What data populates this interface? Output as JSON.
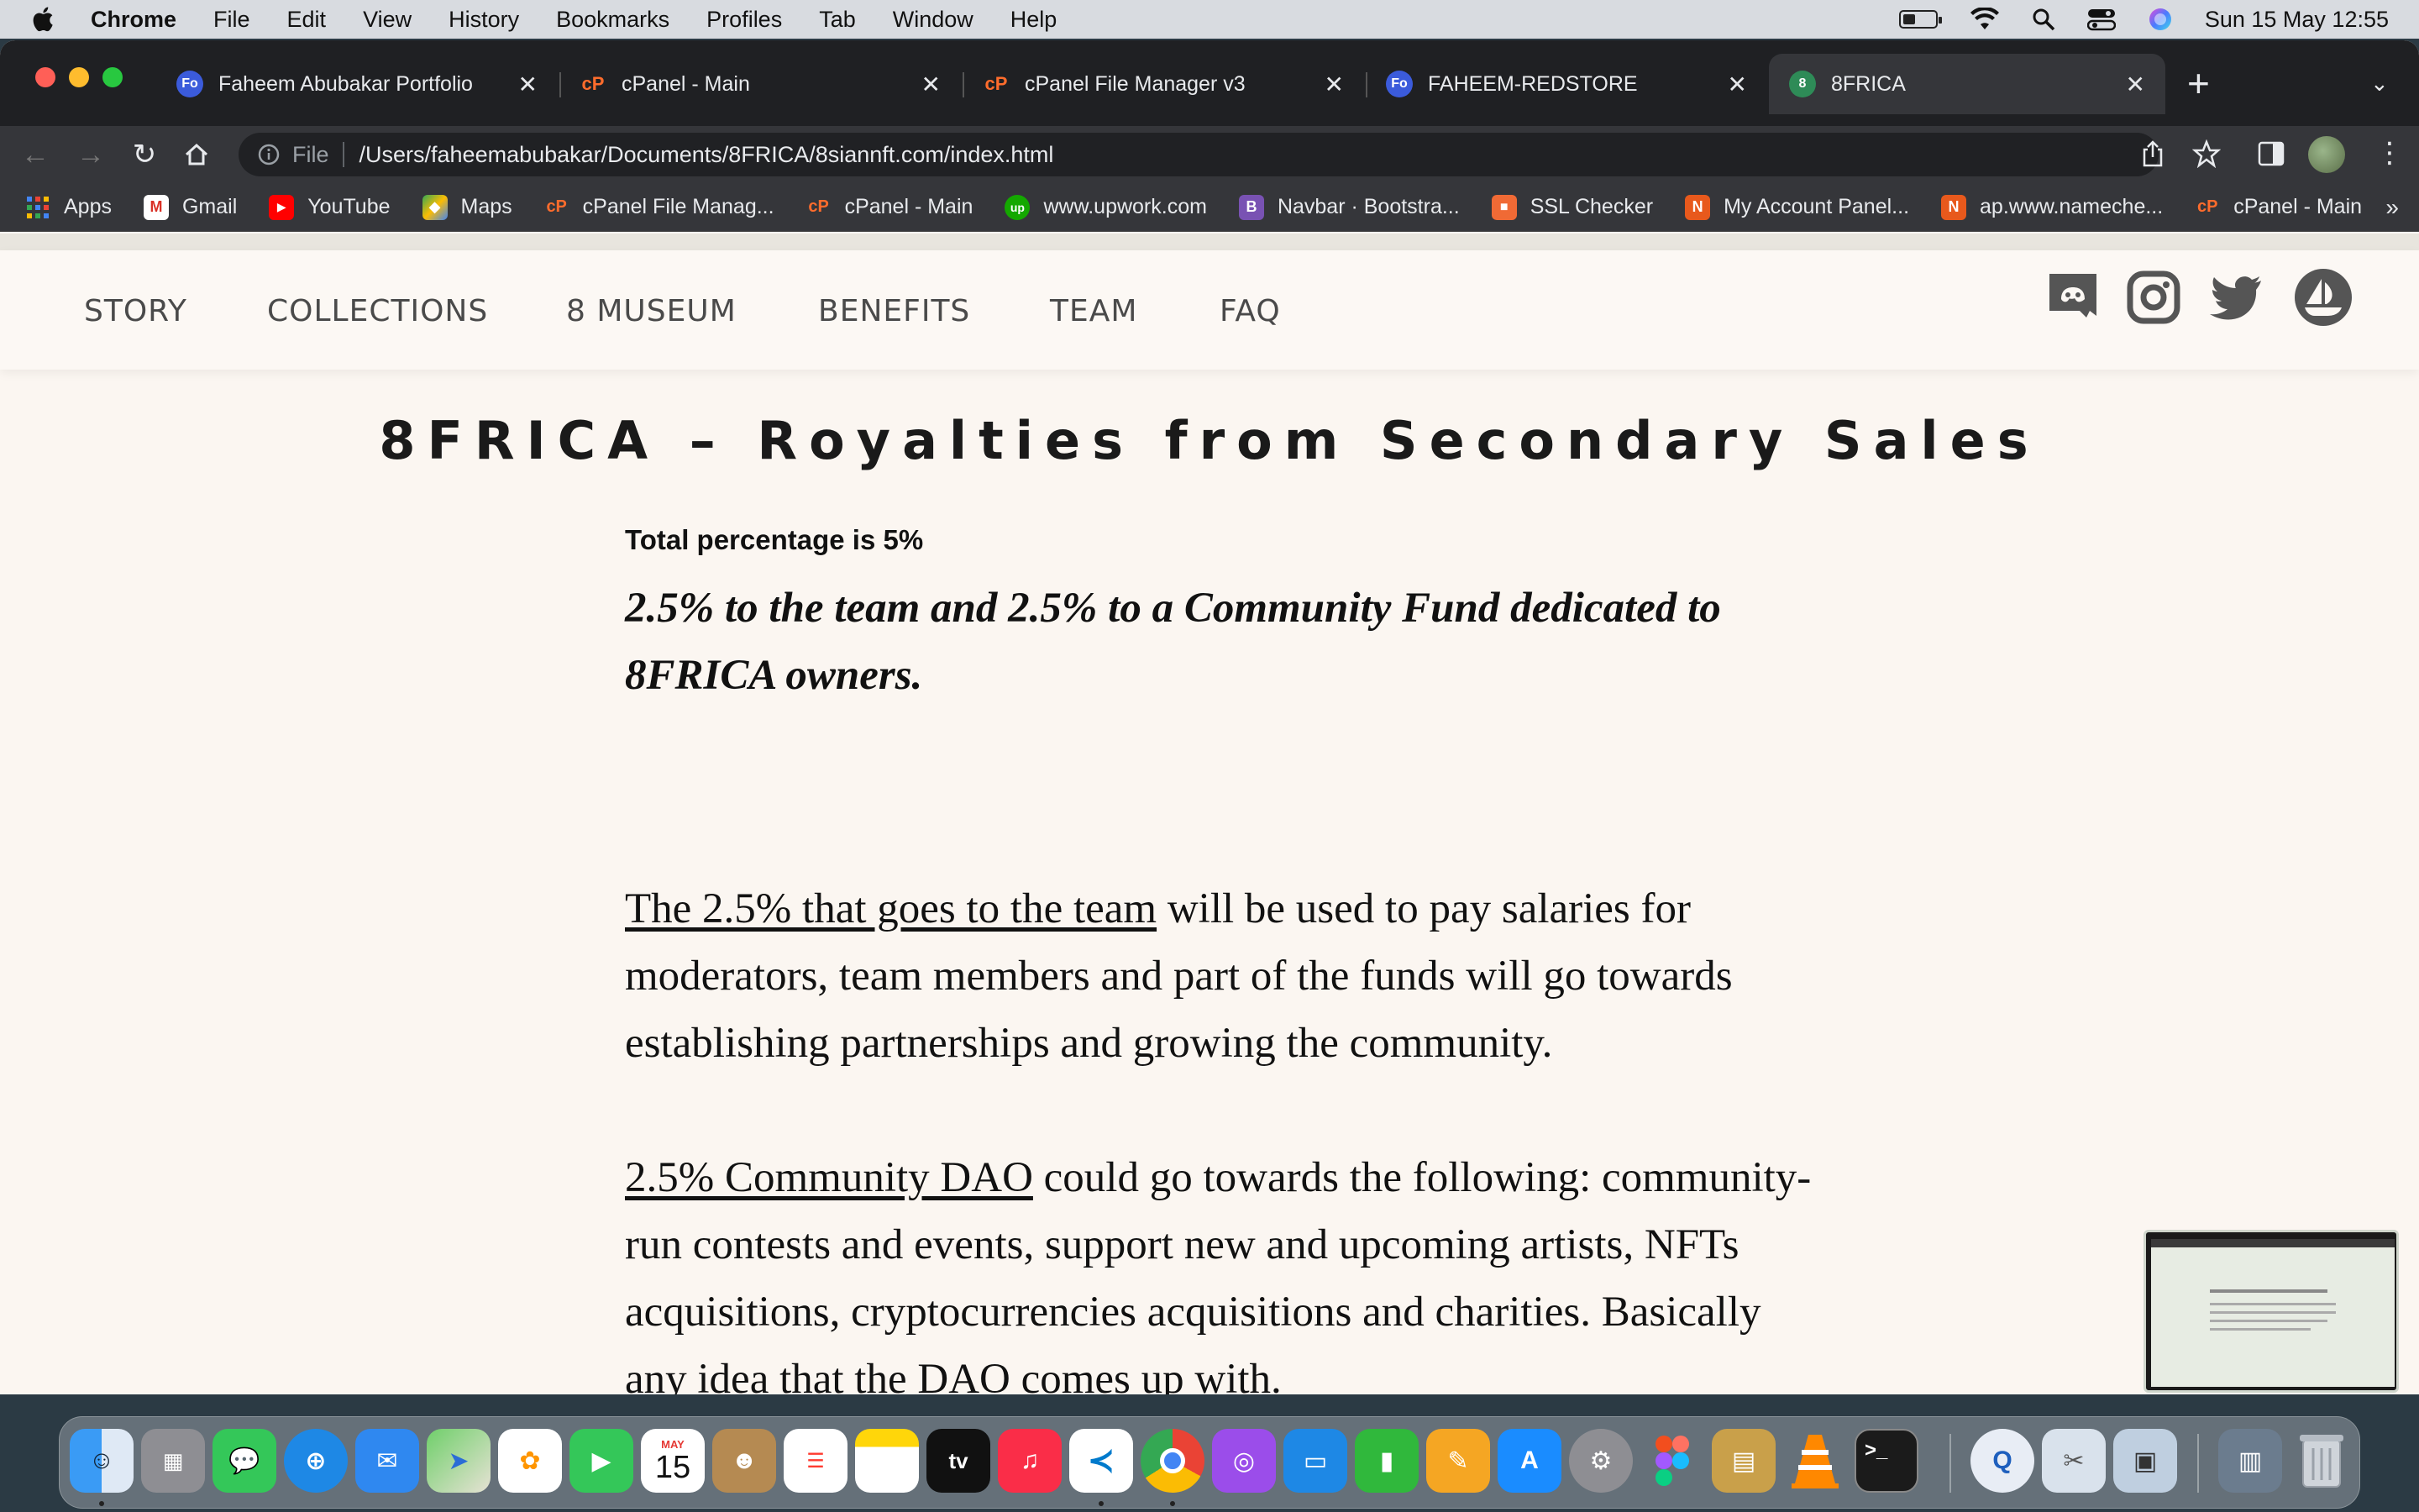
{
  "menubar": {
    "app": "Chrome",
    "items": [
      "File",
      "Edit",
      "View",
      "History",
      "Bookmarks",
      "Profiles",
      "Tab",
      "Window",
      "Help"
    ],
    "datetime": "Sun 15 May  12:55"
  },
  "tabs": [
    {
      "title": "Faheem Abubakar Portfolio",
      "favicon": "Fo",
      "color": "#3b5bdb"
    },
    {
      "title": "cPanel - Main",
      "favicon": "cP",
      "color": "#ff6c2c"
    },
    {
      "title": "cPanel File Manager v3",
      "favicon": "cP",
      "color": "#ff6c2c"
    },
    {
      "title": "FAHEEM-REDSTORE",
      "favicon": "Fo",
      "color": "#3b5bdb"
    },
    {
      "title": "8FRICA",
      "favicon": "8",
      "color": "#2e8b57"
    }
  ],
  "omnibox": {
    "scheme": "File",
    "url": "/Users/faheemabubakar/Documents/8FRICA/8siannft.com/index.html"
  },
  "bookmarks": [
    {
      "label": "Apps",
      "icon": "apps-grid-icon",
      "color": "#4285f4",
      "glyph": "▦"
    },
    {
      "label": "Gmail",
      "icon": "gmail-icon",
      "color": "#d93025",
      "glyph": "M"
    },
    {
      "label": "YouTube",
      "icon": "youtube-icon",
      "color": "#ff0000",
      "glyph": "▶"
    },
    {
      "label": "Maps",
      "icon": "maps-icon",
      "color": "#34a853",
      "glyph": "◆"
    },
    {
      "label": "cPanel File Manag...",
      "icon": "cpanel-icon",
      "color": "#ff6c2c",
      "glyph": "cP"
    },
    {
      "label": "cPanel - Main",
      "icon": "cpanel-icon",
      "color": "#ff6c2c",
      "glyph": "cP"
    },
    {
      "label": "www.upwork.com",
      "icon": "upwork-icon",
      "color": "#14a800",
      "glyph": "up"
    },
    {
      "label": "Navbar · Bootstra...",
      "icon": "bootstrap-icon",
      "color": "#7952b3",
      "glyph": "B"
    },
    {
      "label": "SSL Checker",
      "icon": "lock-icon",
      "color": "#f06a35",
      "glyph": "■"
    },
    {
      "label": "My Account Panel...",
      "icon": "namecheap-icon",
      "color": "#e8591c",
      "glyph": "N"
    },
    {
      "label": "ap.www.nameche...",
      "icon": "namecheap-icon",
      "color": "#e8591c",
      "glyph": "N"
    },
    {
      "label": "cPanel - Main",
      "icon": "cpanel-icon",
      "color": "#ff6c2c",
      "glyph": "cP"
    }
  ],
  "site": {
    "nav": [
      "STORY",
      "COLLECTIONS",
      "8 MUSEUM",
      "BENEFITS",
      "TEAM",
      "FAQ"
    ],
    "social": [
      "discord-icon",
      "instagram-icon",
      "twitter-icon",
      "opensea-icon"
    ],
    "heading": "8FRICA – Royalties from Secondary Sales",
    "total": "Total percentage is 5%",
    "lead": "2.5% to the team and 2.5% to a Community Fund dedicated to 8FRICA owners.",
    "para1_link": "The 2.5% that goes to the team",
    "para1_text": " will be used to pay salaries for moderators, team members and part of the funds will go towards establishing partnerships and growing the community.",
    "para2_link": "2.5% Community DAO",
    "para2_text": " could go towards the following: community-run contests and events, support new and upcoming artists, NFTs acquisitions, cryptocurrencies acquisitions and charities. Basically any idea that the DAO comes up with."
  },
  "dock": {
    "calendar_month": "MAY",
    "calendar_day": "15",
    "tv_label": "tv"
  }
}
